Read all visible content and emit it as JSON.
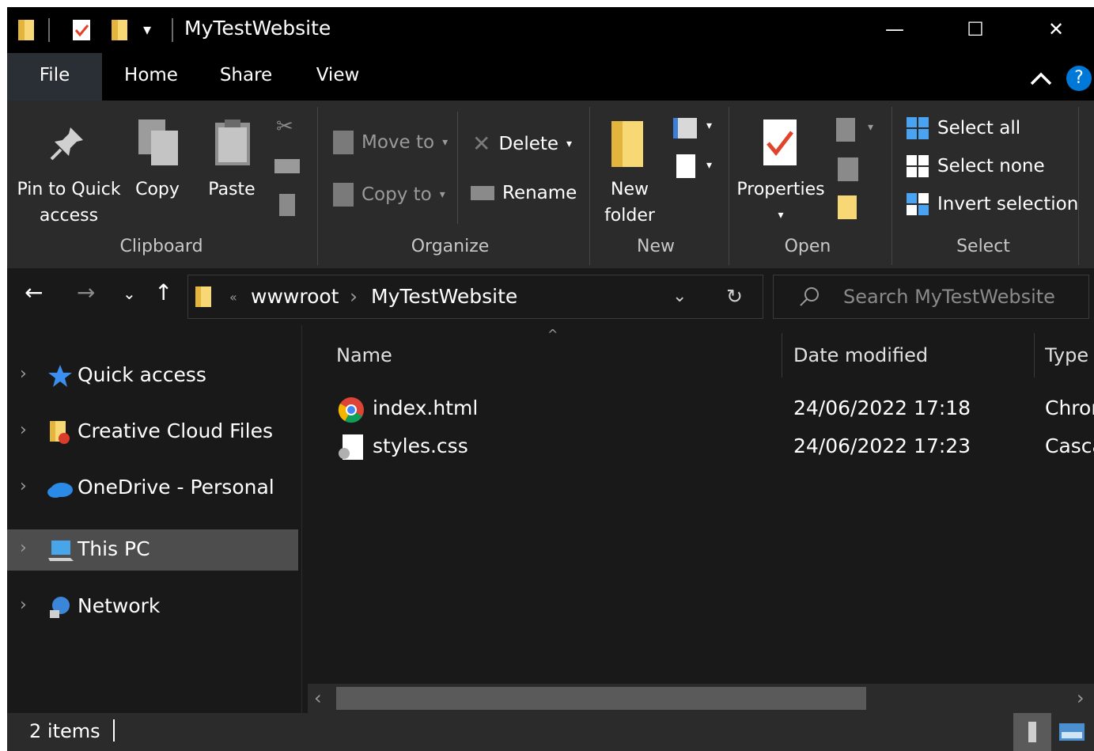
{
  "titlebar": {
    "title": "MyTestWebsite",
    "minimize": "—",
    "maximize": "☐",
    "close": "✕"
  },
  "tabs": {
    "file": "File",
    "home": "Home",
    "share": "Share",
    "view": "View",
    "help": "?"
  },
  "ribbon": {
    "clipboard": {
      "pin_line1": "Pin to Quick",
      "pin_line2": "access",
      "copy": "Copy",
      "paste": "Paste",
      "label": "Clipboard"
    },
    "organize": {
      "move_to": "Move to",
      "copy_to": "Copy to",
      "delete": "Delete",
      "rename": "Rename",
      "label": "Organize"
    },
    "new": {
      "folder_line1": "New",
      "folder_line2": "folder",
      "label": "New"
    },
    "open": {
      "properties": "Properties",
      "label": "Open"
    },
    "select": {
      "select_all": "Select all",
      "select_none": "Select none",
      "invert": "Invert selection",
      "label": "Select"
    }
  },
  "address": {
    "crumb_overflow": "«",
    "crumb1": "wwwroot",
    "crumb_sep": "›",
    "crumb2": "MyTestWebsite"
  },
  "search": {
    "placeholder": "Search MyTestWebsite"
  },
  "navpane": {
    "items": [
      {
        "label": "Quick access",
        "icon": "star-icon"
      },
      {
        "label": "Creative Cloud Files",
        "icon": "creative-cloud-folder-icon"
      },
      {
        "label": "OneDrive - Personal",
        "icon": "onedrive-icon"
      },
      {
        "label": "This PC",
        "icon": "computer-icon",
        "selected": true
      },
      {
        "label": "Network",
        "icon": "network-icon"
      }
    ]
  },
  "filelist": {
    "columns": {
      "name": "Name",
      "date": "Date modified",
      "type": "Type"
    },
    "files": [
      {
        "name": "index.html",
        "date": "24/06/2022 17:18",
        "type": "Chrome HTML Document",
        "icon": "chrome-icon"
      },
      {
        "name": "styles.css",
        "date": "24/06/2022 17:23",
        "type": "Cascading Style Sheet Document",
        "icon": "css-file-icon"
      }
    ]
  },
  "status": {
    "items": "2 items"
  },
  "colors": {
    "background": "#191919",
    "titlebar": "#000000",
    "ribbon": "#2b2b2b",
    "selected": "#4d4d4d",
    "folder": "#f8d775",
    "accent": "#0078d7"
  }
}
